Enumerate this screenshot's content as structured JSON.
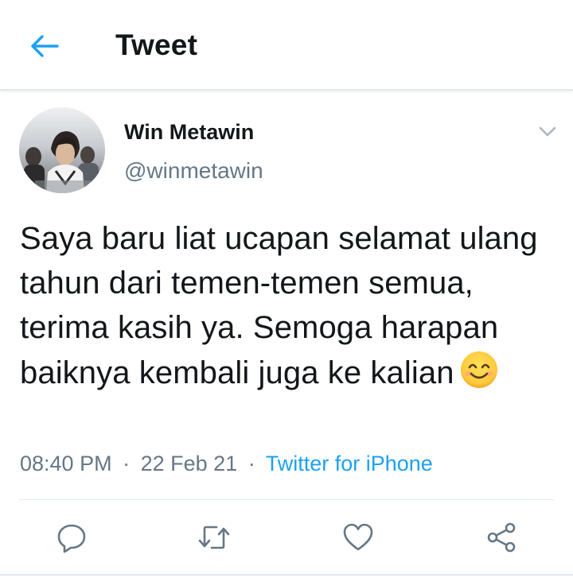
{
  "header": {
    "title": "Tweet",
    "back_icon": "back-arrow-icon"
  },
  "tweet": {
    "author_name": "Win Metawin",
    "author_handle": "@winmetawin",
    "text": "Saya baru liat ucapan selamat ulang tahun dari temen-temen semua, terima kasih ya. Semoga harapan baiknya kembali juga ke kalian",
    "emoji": "smiling-face-emoji",
    "time": "08:40 PM",
    "separator": "·",
    "date": "22 Feb 21",
    "source": "Twitter for iPhone"
  },
  "actions": [
    "reply-icon",
    "retweet-icon",
    "like-icon",
    "share-icon"
  ],
  "colors": {
    "accent": "#1da1f2",
    "text_primary": "#14171a",
    "text_secondary": "#657786",
    "icon_gray": "#657786",
    "divider": "#e1e8ed"
  }
}
